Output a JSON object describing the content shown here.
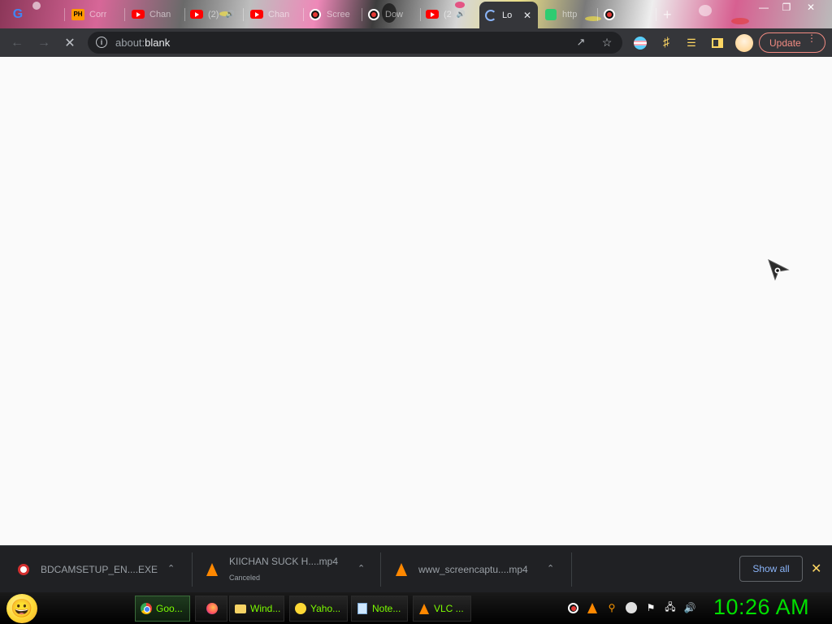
{
  "browser": {
    "tabs": [
      {
        "icon": "google-icon",
        "title": ""
      },
      {
        "icon": "pornhub-icon",
        "title": "Corr"
      },
      {
        "icon": "youtube-icon",
        "title": "Chan"
      },
      {
        "icon": "youtube-icon",
        "title": "(2)"
      },
      {
        "icon": "youtube-icon",
        "title": "Chan"
      },
      {
        "icon": "record-icon",
        "title": "Scree"
      },
      {
        "icon": "record-icon",
        "title": "Dow"
      },
      {
        "icon": "youtube-icon",
        "title": "(2"
      },
      {
        "icon": "loading-spinner-icon",
        "title": "Lo"
      },
      {
        "icon": "green-app-icon",
        "title": "http"
      },
      {
        "icon": "record-icon",
        "title": ""
      }
    ],
    "active_tab_index": 8,
    "new_tab_label": "+",
    "address_bar": {
      "scheme": "about:",
      "host": "blank"
    },
    "update_label": "Update"
  },
  "downloads": [
    {
      "icon": "bdcam-icon",
      "filename": "BDCAMSETUP_EN....EXE",
      "status": ""
    },
    {
      "icon": "vlc-icon",
      "filename": "KIICHAN SUCK H....mp4",
      "status": "Canceled"
    },
    {
      "icon": "vlc-icon",
      "filename": "www_screencaptu....mp4",
      "status": ""
    }
  ],
  "show_all_label": "Show all",
  "taskbar": {
    "tasks": [
      {
        "icon": "chrome-icon",
        "label": "Goo..."
      },
      {
        "icon": "firefox-icon",
        "label": ""
      },
      {
        "icon": "folder-icon",
        "label": "Wind..."
      },
      {
        "icon": "yahoo-messenger-icon",
        "label": "Yaho..."
      },
      {
        "icon": "notepad-icon",
        "label": "Note..."
      },
      {
        "icon": "vlc-icon",
        "label": "VLC ..."
      }
    ],
    "clock": "10:26 AM"
  },
  "colors": {
    "toolbar": "#35363a",
    "update_accent": "#f28b82",
    "clock": "#00e000",
    "task_text": "#7CFC00"
  }
}
